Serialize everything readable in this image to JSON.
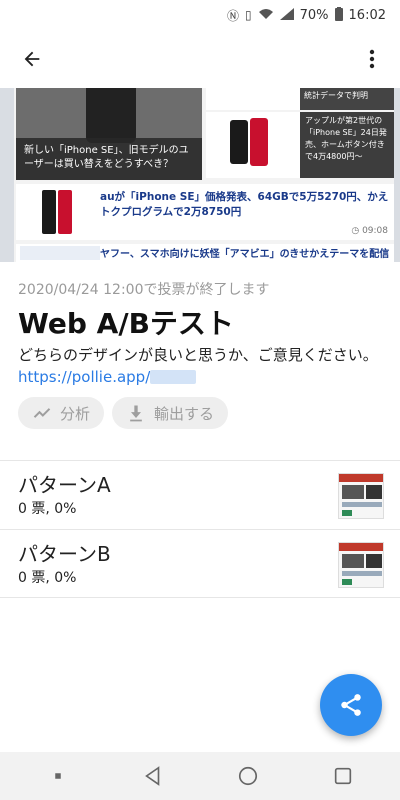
{
  "status_bar": {
    "battery": "70%",
    "time": "16:02",
    "icons": [
      "nfc-icon",
      "vibrate-icon",
      "wifi-icon",
      "signal-icon",
      "battery-icon"
    ]
  },
  "app_bar": {
    "back_icon": "back-arrow-icon",
    "menu_icon": "more-vert-icon"
  },
  "preview": {
    "hero_caption": "新しい「iPhone SE」、旧モデルのユーザーは買い替えをどうすべき？",
    "side_top": "統計データで判明",
    "side_article": "アップルが第2世代の「iPhone SE」24日発売、ホームボタン付きで4万4800円～",
    "article_title": "auが「iPhone SE」価格発表、64GBで5万5270円、かえトクプログラムで2万8750円",
    "article_time": "09:08",
    "bottom_title": "ヤフー、スマホ向けに妖怪「アマビエ」のきせかえテーマを配信"
  },
  "poll": {
    "deadline": "2020/04/24 12:00で投票が終了します",
    "title": "Web A/Bテスト",
    "description": "どちらのデザインが良いと思うか、ご意見ください。",
    "link": "https://pollie.app/"
  },
  "actions": {
    "analyze_label": "分析",
    "analyze_icon": "trending-line-icon",
    "export_label": "輸出する",
    "export_icon": "download-icon"
  },
  "options": [
    {
      "name": "パターンA",
      "votes": "0 票, 0%"
    },
    {
      "name": "パターンB",
      "votes": "0 票, 0%"
    }
  ],
  "fab": {
    "icon": "share-icon",
    "color": "#2f8ef0"
  },
  "nav_bar": {
    "icons": [
      "recent-apps-dot-icon",
      "back-triangle-icon",
      "home-circle-icon",
      "overview-square-icon"
    ]
  }
}
